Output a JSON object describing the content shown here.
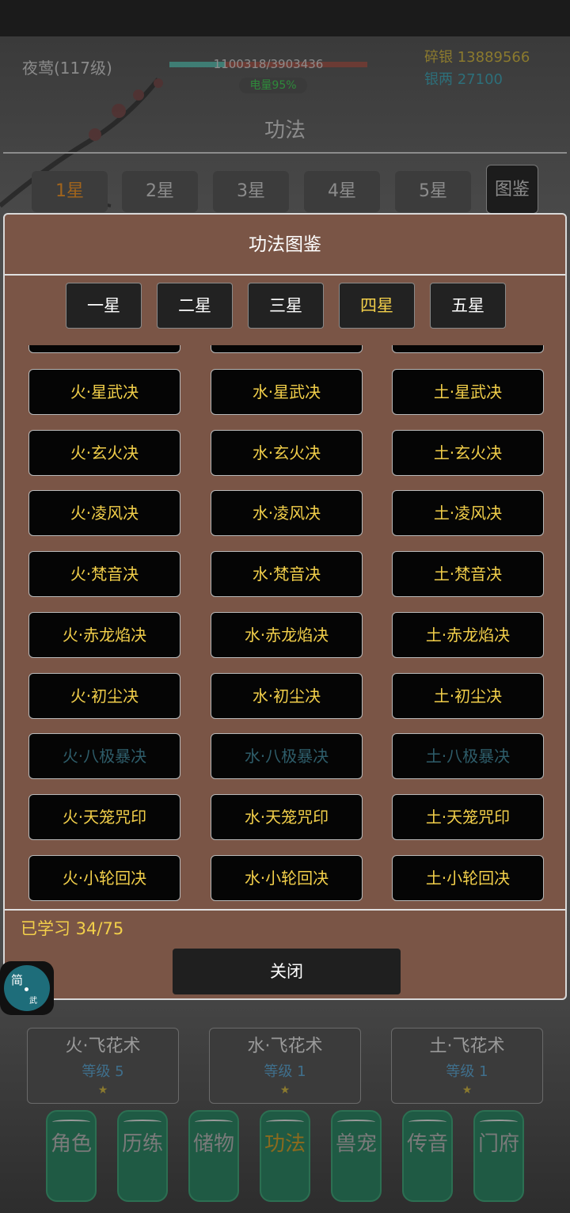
{
  "header": {
    "player_name": "夜莺(117级)",
    "exp_text": "1100318/3903436",
    "exp_fraction": 0.28,
    "battery_text": "电量95%",
    "silver_fragments": "碎银 13889566",
    "silver_taels": "银两 27100",
    "page_title": "功法"
  },
  "star_tabs": [
    {
      "label": "1星"
    },
    {
      "label": "2星"
    },
    {
      "label": "3星"
    },
    {
      "label": "4星"
    },
    {
      "label": "5星"
    },
    {
      "label": "图鉴"
    }
  ],
  "background_cards": [
    {
      "name": "火·飞花术",
      "level": "等级 5",
      "star": "★"
    },
    {
      "name": "水·飞花术",
      "level": "等级 1",
      "star": "★"
    },
    {
      "name": "土·飞花术",
      "level": "等级 1",
      "star": "★"
    }
  ],
  "modal": {
    "title": "功法图鉴",
    "tabs": [
      {
        "label": "一星"
      },
      {
        "label": "二星"
      },
      {
        "label": "三星"
      },
      {
        "label": "四星"
      },
      {
        "label": "五星"
      }
    ],
    "active_tab": "四星",
    "grid_rows": [
      [
        "火·星武决",
        "水·星武决",
        "土·星武决"
      ],
      [
        "火·玄火决",
        "水·玄火决",
        "土·玄火决"
      ],
      [
        "火·凌风决",
        "水·凌风决",
        "土·凌风决"
      ],
      [
        "火·梵音决",
        "水·梵音决",
        "土·梵音决"
      ],
      [
        "火·赤龙焰决",
        "水·赤龙焰决",
        "土·赤龙焰决"
      ],
      [
        "火·初尘决",
        "水·初尘决",
        "土·初尘决"
      ],
      [
        "火·八极暴决",
        "水·八极暴决",
        "土·八极暴决"
      ],
      [
        "火·天笼咒印",
        "水·天笼咒印",
        "土·天笼咒印"
      ],
      [
        "火·小轮回决",
        "水·小轮回决",
        "土·小轮回决"
      ]
    ],
    "learned_text": "已学习 34/75",
    "close_label": "关闭"
  },
  "badge": {
    "char_a": "简",
    "char_b": "武"
  },
  "bottom_nav": [
    {
      "label": "角色"
    },
    {
      "label": "历练"
    },
    {
      "label": "储物"
    },
    {
      "label": "功法"
    },
    {
      "label": "兽宠"
    },
    {
      "label": "传音"
    },
    {
      "label": "门府"
    }
  ]
}
